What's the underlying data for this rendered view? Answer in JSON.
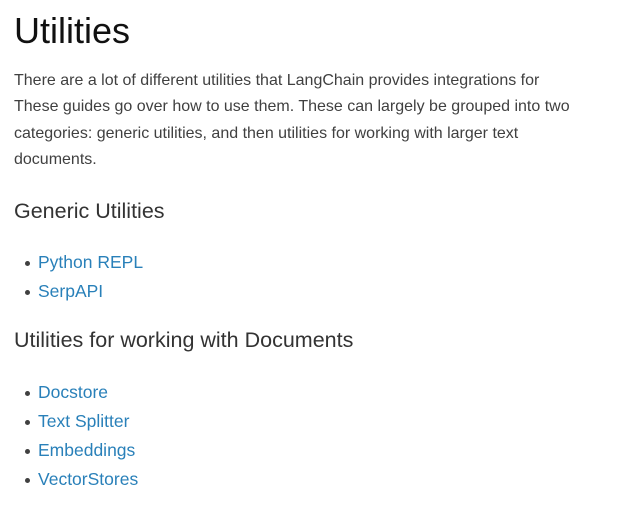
{
  "page": {
    "title": "Utilities",
    "intro": "There are a lot of different utilities that LangChain provides integrations for These guides go over how to use them. These can largely be grouped into two categories: generic utilities, and then utilities for working with larger text documents."
  },
  "generic_section": {
    "heading": "Generic Utilities",
    "links": [
      "Python REPL",
      "SerpAPI"
    ]
  },
  "documents_section": {
    "heading": "Utilities for working with Documents",
    "links": [
      "Docstore",
      "Text Splitter",
      "Embeddings",
      "VectorStores"
    ]
  },
  "colors": {
    "link": "#2980b9",
    "body_text": "#404040",
    "heading": "#111111"
  }
}
